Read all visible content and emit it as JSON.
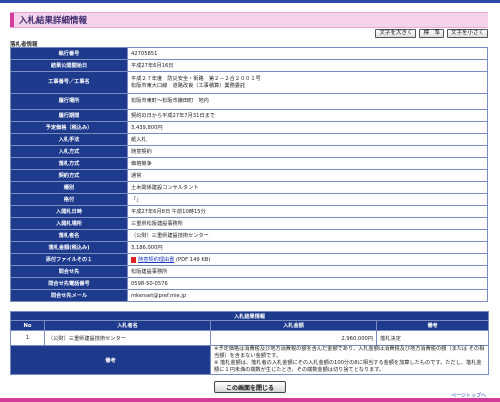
{
  "page": {
    "title": "入札結果詳細情報",
    "section_label": "落札者情報",
    "font_buttons": [
      "文字を大きく",
      "標　準",
      "文字を小さく"
    ],
    "close_button": "この画面を閉じる",
    "page_top": "ページトップへ"
  },
  "details": [
    {
      "label": "執行番号",
      "value": "42705851"
    },
    {
      "label": "結果公開開始日",
      "value": "平成27年6月16日"
    },
    {
      "label": "工事番号／工事名",
      "value": "平成２７年度　防災安全・街路　第２－２合２００１号",
      "value2": "松阪市東大口線　道路改良（工事積算）業務委託"
    },
    {
      "label": "履行場所",
      "value": "松阪市東町～松阪市鎌田町　地内"
    },
    {
      "label": "履行期間",
      "value": "契約の日から平成27年7月31日まで"
    },
    {
      "label": "予定価格（税込み）",
      "value": "3,439,800円"
    },
    {
      "label": "入札手法",
      "value": "紙入札"
    },
    {
      "label": "入札方式",
      "value": "随意契約"
    },
    {
      "label": "落札方式",
      "value": "価格競争"
    },
    {
      "label": "契約方式",
      "value": "通常"
    },
    {
      "label": "種別",
      "value": "土木関係建設コンサルタント"
    },
    {
      "label": "格付",
      "value": "「」"
    },
    {
      "label": "入開札日時",
      "value": "平成27年6月8日 午前10時15分"
    },
    {
      "label": "入開札場所",
      "value": "三重県松阪建設事務所"
    },
    {
      "label": "落札者名",
      "value": "（公財）三重県建設技術センター"
    },
    {
      "label": "落札金額(税込み)",
      "value": "3,186,000円"
    },
    {
      "label": "添付ファイルその１",
      "link": "随意契約理由書",
      "suffix": "(PDF 149 KB)"
    },
    {
      "label": "問合せ先",
      "value": "松阪建設事務所"
    },
    {
      "label": "問合せ先電話番号",
      "value": "0598-50-0576"
    },
    {
      "label": "問合せ先メール",
      "value": "mkenset@pref.mie.jp"
    }
  ],
  "results": {
    "caption": "入札結果情報",
    "headers": [
      "No",
      "入札者名",
      "入札金額",
      "備考"
    ],
    "rows": [
      {
        "no": "1",
        "name": "（公財）三重県建設技術センター",
        "amount": "2,960,000円",
        "remarks": "落札決定"
      }
    ],
    "note_label": "備考",
    "note_lines": [
      "※予定価格は消費税及び地方消費税の額を含んだ金額であり、入札金額は消費税及び地方消費税の額（または その相当額）を含まない金額です。",
      "※ 落札金額は、落札者の入札金額にその入札金額の100分の8に相当する金額を加算したものです。ただし、落札金額に１円未満の端数が生じたとき、その端数金額は切り捨てとなります。"
    ]
  }
}
